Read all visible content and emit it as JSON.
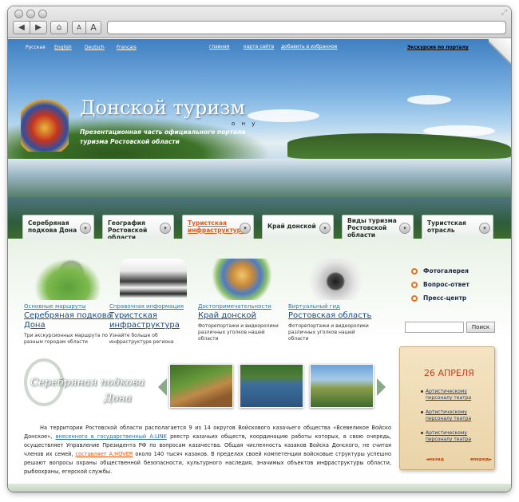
{
  "browser": {
    "back_icon": "arrow-left-icon",
    "forward_icon": "arrow-right-icon",
    "home_icon": "home-icon",
    "font_small": "A",
    "font_large": "A",
    "url": ""
  },
  "header": {
    "languages": [
      "Русская",
      "English",
      "Deutsch",
      "Français"
    ],
    "top_links": [
      "главная",
      "карта сайта",
      "добавить в избранное"
    ],
    "tour_link": "Экскурсия по порталу",
    "site_title": "Донской туризм",
    "site_subtitle": "о н у",
    "site_description": "Презентационная часть официального портала туризма Ростовской области"
  },
  "nav": {
    "tabs": [
      {
        "label": "Серебряная подкова Дона"
      },
      {
        "label": "География Ростовской области"
      },
      {
        "label": "Туристская инфраструктура"
      },
      {
        "label": "Край донской"
      },
      {
        "label": "Виды туризма Ростовской области"
      },
      {
        "label": "Туристская отрасль"
      }
    ],
    "active_index": 2
  },
  "features": [
    {
      "category": "Основные маршруты",
      "title": "Серебряная подкова Дона",
      "description": "Три экскурсионных маршрута по разным городам области"
    },
    {
      "category": "Справочная информация",
      "title": "Туристская инфраструктура",
      "description": "Узнайте больше об инфраструктуре региона"
    },
    {
      "category": "Достопримечательности",
      "title": "Край донской",
      "description": "Фоторепортажи и видеоролики различных уголков нашей области"
    },
    {
      "category": "Виртуальный гид",
      "title": "Ростовская область",
      "description": "Фоторепортажи и видеоролики различных уголков нашей области"
    }
  ],
  "side_links": [
    "Фотогалерея",
    "Вопрос-ответ",
    "Пресс-центр"
  ],
  "search": {
    "placeholder": "",
    "button": "Поиск"
  },
  "calendar": {
    "date": "26 АПРЕЛЯ",
    "items": [
      "Артистическому персоналу театра",
      "Артистическому персоналу театра",
      "Артистическому персоналу театра"
    ],
    "prev": "◄назад",
    "next": "вперед►"
  },
  "horseshoe_logo": {
    "line1": "Серебряная подкова",
    "line2": "Дона"
  },
  "article": {
    "p1": "На территории Ростовской области располагается 9 из 14 округов Войскового казачьего общества «Всевеликое Войско Донское»,",
    "link1": "внесенного в государственный A:LINK",
    "p2": "реестр казачьих обществ, координацию работы которых, в свою очередь, осуществляет Управление Президента РФ по вопросам казачества. Общая численность казаков Войска Донского, не считая членов их семей,",
    "link2": "составляет A:HOVER",
    "p3": "около 140 тысяч казаков. В пределах своей компетенции войсковые структуры успешно решают вопросы охраны общественной безопасности, культурного наследия, значимых объектов инфраструктуры области, рыбоохраны, егерской службы."
  },
  "colors": {
    "accent_orange": "#e35a19",
    "link_blue": "#1a4b8c",
    "calendar_red": "#cc3c1c"
  }
}
